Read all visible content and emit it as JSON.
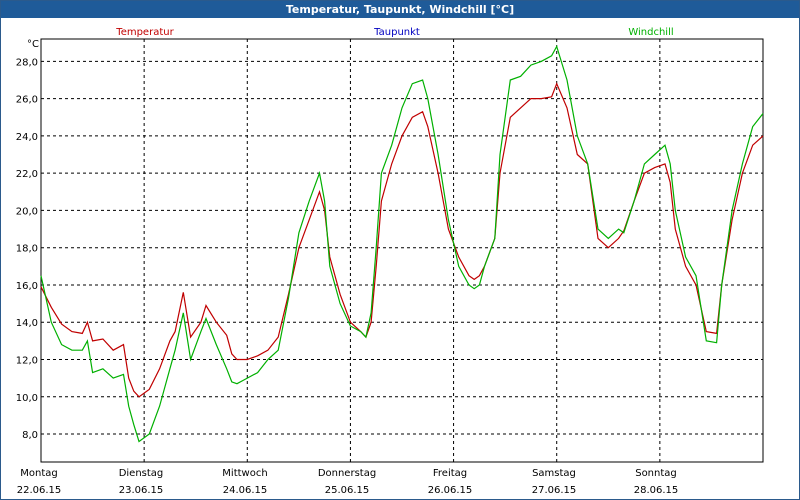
{
  "window": {
    "title": "Temperatur, Taupunkt, Windchill [°C]"
  },
  "colors": {
    "temperatur": "#c00000",
    "taupunkt": "#0000c0",
    "windchill": "#00b000",
    "grid": "#000000"
  },
  "chart_data": {
    "type": "line",
    "title": "Temperatur, Taupunkt, Windchill [°C]",
    "ylabel": "°C",
    "ylim": [
      6.5,
      29.2
    ],
    "yticks": [
      "8,0",
      "10,0",
      "12,0",
      "14,0",
      "16,0",
      "18,0",
      "20,0",
      "22,0",
      "24,0",
      "26,0",
      "28,0"
    ],
    "grid": true,
    "legend_position": "top",
    "x_days": [
      {
        "day": "Montag",
        "date": "22.06.15"
      },
      {
        "day": "Dienstag",
        "date": "23.06.15"
      },
      {
        "day": "Mittwoch",
        "date": "24.06.15"
      },
      {
        "day": "Donnerstag",
        "date": "25.06.15"
      },
      {
        "day": "Freitag",
        "date": "26.06.15"
      },
      {
        "day": "Samstag",
        "date": "27.06.15"
      },
      {
        "day": "Sonntag",
        "date": "28.06.15"
      }
    ],
    "x_unit": "days since 22.06.15 00:00",
    "xlim": [
      0,
      7.0
    ],
    "series": [
      {
        "name": "Temperatur",
        "color": "#c00000",
        "points": [
          [
            0.0,
            15.9
          ],
          [
            0.1,
            14.8
          ],
          [
            0.2,
            13.9
          ],
          [
            0.3,
            13.5
          ],
          [
            0.4,
            13.4
          ],
          [
            0.45,
            14.0
          ],
          [
            0.5,
            13.0
          ],
          [
            0.6,
            13.1
          ],
          [
            0.7,
            12.5
          ],
          [
            0.8,
            12.8
          ],
          [
            0.85,
            11.0
          ],
          [
            0.9,
            10.3
          ],
          [
            0.95,
            10.0
          ],
          [
            1.05,
            10.4
          ],
          [
            1.15,
            11.5
          ],
          [
            1.25,
            13.0
          ],
          [
            1.3,
            13.5
          ],
          [
            1.38,
            15.6
          ],
          [
            1.45,
            13.2
          ],
          [
            1.55,
            14.0
          ],
          [
            1.6,
            14.9
          ],
          [
            1.7,
            14.0
          ],
          [
            1.8,
            13.3
          ],
          [
            1.85,
            12.3
          ],
          [
            1.9,
            12.0
          ],
          [
            2.0,
            12.0
          ],
          [
            2.1,
            12.2
          ],
          [
            2.2,
            12.5
          ],
          [
            2.3,
            13.2
          ],
          [
            2.4,
            15.5
          ],
          [
            2.5,
            18.0
          ],
          [
            2.6,
            19.5
          ],
          [
            2.7,
            21.0
          ],
          [
            2.75,
            20.0
          ],
          [
            2.8,
            17.5
          ],
          [
            2.9,
            15.5
          ],
          [
            3.0,
            14.0
          ],
          [
            3.1,
            13.5
          ],
          [
            3.15,
            13.2
          ],
          [
            3.2,
            14.0
          ],
          [
            3.25,
            17.0
          ],
          [
            3.3,
            20.5
          ],
          [
            3.4,
            22.5
          ],
          [
            3.5,
            24.0
          ],
          [
            3.6,
            25.0
          ],
          [
            3.7,
            25.3
          ],
          [
            3.75,
            24.5
          ],
          [
            3.85,
            22.0
          ],
          [
            3.95,
            19.0
          ],
          [
            4.05,
            17.5
          ],
          [
            4.15,
            16.5
          ],
          [
            4.2,
            16.3
          ],
          [
            4.25,
            16.5
          ],
          [
            4.3,
            17.0
          ],
          [
            4.4,
            18.5
          ],
          [
            4.45,
            22.0
          ],
          [
            4.55,
            25.0
          ],
          [
            4.65,
            25.5
          ],
          [
            4.75,
            26.0
          ],
          [
            4.85,
            26.0
          ],
          [
            4.95,
            26.1
          ],
          [
            5.0,
            26.8
          ],
          [
            5.1,
            25.5
          ],
          [
            5.2,
            23.0
          ],
          [
            5.3,
            22.5
          ],
          [
            5.4,
            18.5
          ],
          [
            5.5,
            18.0
          ],
          [
            5.6,
            18.5
          ],
          [
            5.65,
            18.9
          ],
          [
            5.75,
            20.5
          ],
          [
            5.85,
            22.0
          ],
          [
            5.95,
            22.3
          ],
          [
            6.05,
            22.5
          ],
          [
            6.1,
            21.5
          ],
          [
            6.15,
            19.0
          ],
          [
            6.25,
            17.0
          ],
          [
            6.35,
            16.0
          ],
          [
            6.45,
            13.5
          ],
          [
            6.55,
            13.4
          ],
          [
            6.6,
            16.0
          ],
          [
            6.7,
            19.5
          ],
          [
            6.8,
            22.0
          ],
          [
            6.9,
            23.5
          ],
          [
            7.0,
            24.0
          ]
        ]
      },
      {
        "name": "Taupunkt",
        "color": "#0000c0",
        "points": []
      },
      {
        "name": "Windchill",
        "color": "#00b000",
        "points": [
          [
            0.0,
            16.5
          ],
          [
            0.1,
            14.0
          ],
          [
            0.2,
            12.8
          ],
          [
            0.3,
            12.5
          ],
          [
            0.4,
            12.5
          ],
          [
            0.45,
            13.0
          ],
          [
            0.5,
            11.3
          ],
          [
            0.6,
            11.5
          ],
          [
            0.7,
            11.0
          ],
          [
            0.8,
            11.2
          ],
          [
            0.85,
            9.5
          ],
          [
            0.9,
            8.5
          ],
          [
            0.95,
            7.6
          ],
          [
            1.05,
            8.0
          ],
          [
            1.15,
            9.5
          ],
          [
            1.25,
            11.5
          ],
          [
            1.3,
            12.5
          ],
          [
            1.38,
            14.5
          ],
          [
            1.45,
            12.0
          ],
          [
            1.55,
            13.5
          ],
          [
            1.6,
            14.2
          ],
          [
            1.7,
            12.8
          ],
          [
            1.8,
            11.5
          ],
          [
            1.85,
            10.8
          ],
          [
            1.9,
            10.7
          ],
          [
            2.0,
            11.0
          ],
          [
            2.1,
            11.3
          ],
          [
            2.2,
            12.0
          ],
          [
            2.3,
            12.5
          ],
          [
            2.4,
            15.3
          ],
          [
            2.5,
            18.8
          ],
          [
            2.6,
            20.5
          ],
          [
            2.7,
            22.0
          ],
          [
            2.75,
            20.5
          ],
          [
            2.8,
            17.0
          ],
          [
            2.9,
            15.0
          ],
          [
            3.0,
            13.8
          ],
          [
            3.1,
            13.5
          ],
          [
            3.15,
            13.2
          ],
          [
            3.2,
            14.5
          ],
          [
            3.25,
            18.0
          ],
          [
            3.3,
            22.0
          ],
          [
            3.4,
            23.5
          ],
          [
            3.5,
            25.5
          ],
          [
            3.6,
            26.8
          ],
          [
            3.7,
            27.0
          ],
          [
            3.75,
            26.0
          ],
          [
            3.85,
            23.0
          ],
          [
            3.95,
            19.5
          ],
          [
            4.05,
            17.0
          ],
          [
            4.15,
            16.0
          ],
          [
            4.2,
            15.8
          ],
          [
            4.25,
            16.0
          ],
          [
            4.3,
            17.0
          ],
          [
            4.4,
            18.5
          ],
          [
            4.45,
            23.0
          ],
          [
            4.55,
            27.0
          ],
          [
            4.65,
            27.2
          ],
          [
            4.75,
            27.8
          ],
          [
            4.85,
            28.0
          ],
          [
            4.95,
            28.3
          ],
          [
            5.0,
            28.8
          ],
          [
            5.1,
            27.0
          ],
          [
            5.2,
            24.0
          ],
          [
            5.3,
            22.5
          ],
          [
            5.4,
            19.0
          ],
          [
            5.5,
            18.5
          ],
          [
            5.6,
            19.0
          ],
          [
            5.65,
            18.8
          ],
          [
            5.75,
            20.5
          ],
          [
            5.85,
            22.5
          ],
          [
            5.95,
            23.0
          ],
          [
            6.05,
            23.5
          ],
          [
            6.1,
            22.5
          ],
          [
            6.15,
            20.0
          ],
          [
            6.25,
            17.5
          ],
          [
            6.35,
            16.5
          ],
          [
            6.45,
            13.0
          ],
          [
            6.55,
            12.9
          ],
          [
            6.6,
            16.0
          ],
          [
            6.7,
            20.0
          ],
          [
            6.8,
            22.5
          ],
          [
            6.9,
            24.5
          ],
          [
            7.0,
            25.2
          ]
        ]
      }
    ]
  }
}
